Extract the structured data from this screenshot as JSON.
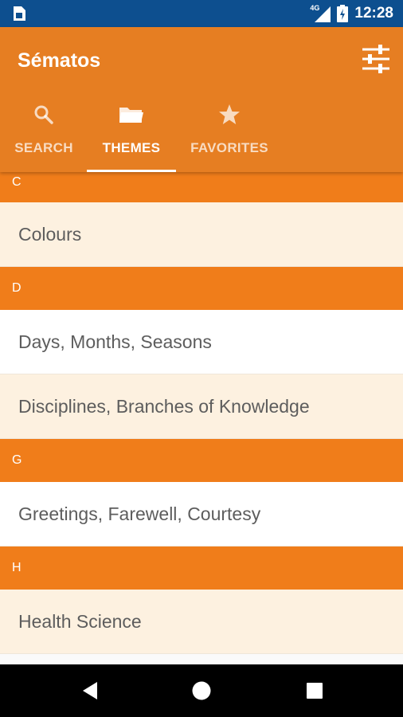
{
  "status_bar": {
    "time": "12:28",
    "network": "4G",
    "icons": [
      "sim-card-icon",
      "signal-icon",
      "battery-charging-icon"
    ]
  },
  "app": {
    "title": "Sématos",
    "actions": [
      {
        "icon": "filter-sliders-icon"
      }
    ]
  },
  "tabs": [
    {
      "label": "SEARCH",
      "icon": "search-icon",
      "active": false
    },
    {
      "label": "THEMES",
      "icon": "folder-icon",
      "active": true
    },
    {
      "label": "FAVORITES",
      "icon": "star-icon",
      "active": false
    }
  ],
  "sections": [
    {
      "letter": "C",
      "items": [
        "Colours"
      ]
    },
    {
      "letter": "D",
      "items": [
        "Days, Months, Seasons",
        "Disciplines, Branches of Knowledge"
      ]
    },
    {
      "letter": "G",
      "items": [
        "Greetings, Farewell, Courtesy"
      ]
    },
    {
      "letter": "H",
      "items": [
        "Health Science"
      ]
    }
  ],
  "nav_bar": {
    "buttons": [
      "back-icon",
      "home-icon",
      "recents-icon"
    ]
  },
  "colors": {
    "status_bar": "#0d4f8f",
    "app_bar": "#e67e22",
    "section_header": "#f07d1a",
    "row_cream": "#fdf1e0",
    "row_white": "#ffffff",
    "row_text": "#5d5d5d"
  }
}
